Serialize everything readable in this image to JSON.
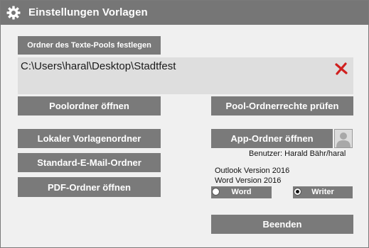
{
  "window": {
    "title": "Einstellungen Vorlagen",
    "title_icon": "gear-icon"
  },
  "pool": {
    "set_button": "Ordner des Texte-Pools festlegen",
    "path": "C:\\Users\\haral\\Desktop\\Stadtfest",
    "clear_icon": "red-x-icon",
    "open_button": "Poolordner öffnen",
    "check_rights_button": "Pool-Ordnerrechte prüfen"
  },
  "buttons": {
    "local_templates": "Lokaler Vorlagenordner",
    "default_mail": "Standard-E-Mail-Ordner",
    "pdf_folder": "PDF-Ordner öffnen",
    "app_folder": "App-Ordner öffnen",
    "quit": "Beenden"
  },
  "user": {
    "avatar_icon": "user-avatar-icon",
    "label": "Benutzer: Harald Bähr/haral"
  },
  "versions": {
    "outlook": "Outlook Version 2016",
    "word": "Word Version 2016"
  },
  "editor_choice": {
    "options": [
      {
        "label": "Word",
        "selected": false
      },
      {
        "label": "Writer",
        "selected": true
      }
    ]
  },
  "colors": {
    "titlebar": "#767676",
    "button": "#7a7a7a",
    "path_box": "#dedede",
    "clear_icon": "#d0201f"
  }
}
